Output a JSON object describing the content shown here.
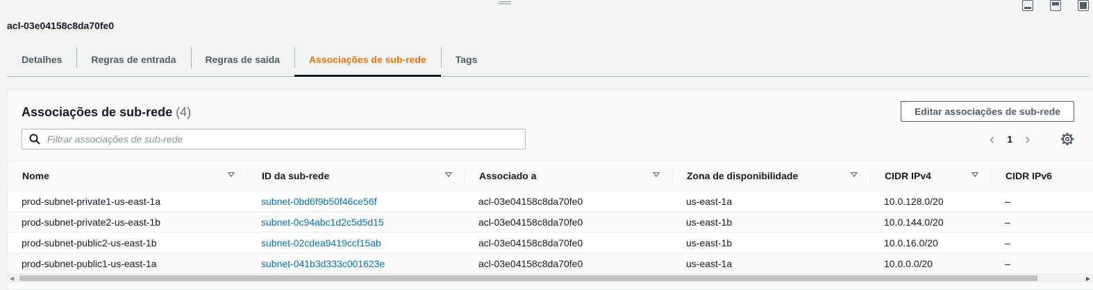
{
  "acl_title": "acl-03e04158c8da70fe0",
  "tabs": [
    {
      "label": "Detalhes"
    },
    {
      "label": "Regras de entrada"
    },
    {
      "label": "Regras de saída"
    },
    {
      "label": "Associações de sub-rede",
      "active": true
    },
    {
      "label": "Tags"
    }
  ],
  "panel": {
    "title": "Associações de sub-rede",
    "count": "(4)",
    "edit_button": "Editar associações de sub-rede",
    "search_placeholder": "Filtrar associações de sub-rede",
    "page": "1"
  },
  "table": {
    "columns": [
      "Nome",
      "ID da sub-rede",
      "Associado a",
      "Zona de disponibilidade",
      "CIDR IPv4",
      "CIDR IPv6"
    ],
    "rows": [
      [
        "prod-subnet-private1-us-east-1a",
        "subnet-0bd6f9b50f46ce56f",
        "acl-03e04158c8da70fe0",
        "us-east-1a",
        "10.0.128.0/20",
        "–"
      ],
      [
        "prod-subnet-private2-us-east-1b",
        "subnet-0c94abc1d2c5d5d15",
        "acl-03e04158c8da70fe0",
        "us-east-1b",
        "10.0.144.0/20",
        "–"
      ],
      [
        "prod-subnet-public2-us-east-1b",
        "subnet-02cdea9419ccf15ab",
        "acl-03e04158c8da70fe0",
        "us-east-1b",
        "10.0.16.0/20",
        "–"
      ],
      [
        "prod-subnet-public1-us-east-1a",
        "subnet-041b3d333c001623e",
        "acl-03e04158c8da70fe0",
        "us-east-1a",
        "10.0.0.0/20",
        "–"
      ]
    ]
  },
  "colors": {
    "accent": "#ec7211",
    "link": "#0073bb"
  }
}
